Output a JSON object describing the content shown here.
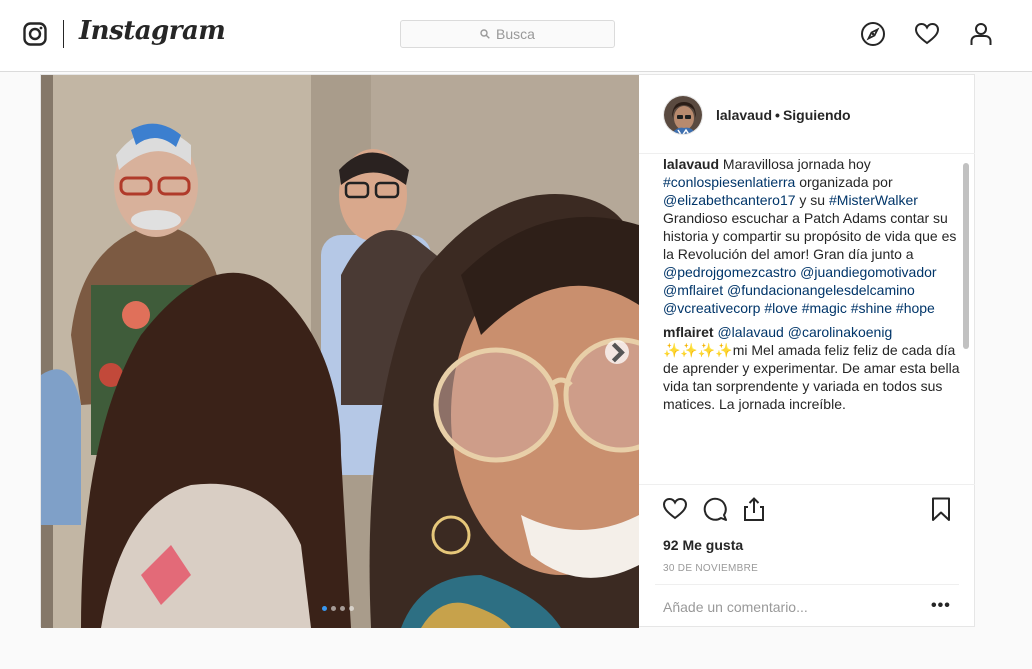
{
  "brand": {
    "wordmark": "Instagram"
  },
  "search": {
    "placeholder": "Busca"
  },
  "nav": {
    "icons": [
      "explore-icon",
      "heart-icon",
      "profile-icon"
    ]
  },
  "post": {
    "username": "lalavaud",
    "separator": "•",
    "follow_status": "Siguiendo",
    "carousel": {
      "total": 4,
      "active": 1
    },
    "caption": {
      "user": "lalavaud",
      "parts": [
        {
          "t": " Maravillosa jornada hoy "
        },
        {
          "t": "#conlospiesenlatierra",
          "link": true
        },
        {
          "t": " organizada por "
        },
        {
          "t": "@elizabethcantero17",
          "link": true
        },
        {
          "t": " y su "
        },
        {
          "t": "#MisterWalker",
          "link": true
        },
        {
          "t": " Grandioso escuchar a Patch Adams contar su historia y compartir su propósito de vida que es la Revolución del amor! Gran día junto a "
        },
        {
          "t": "@pedrojgomezcastro",
          "link": true
        },
        {
          "t": " "
        },
        {
          "t": "@juandiegomotivador",
          "link": true
        },
        {
          "t": " "
        },
        {
          "t": "@mflairet",
          "link": true
        },
        {
          "t": " "
        },
        {
          "t": "@fundacionangelesdelcamino",
          "link": true
        },
        {
          "t": " "
        },
        {
          "t": "@vcreativecorp",
          "link": true
        },
        {
          "t": " "
        },
        {
          "t": "#love",
          "link": true
        },
        {
          "t": " "
        },
        {
          "t": "#magic",
          "link": true
        },
        {
          "t": " "
        },
        {
          "t": "#shine",
          "link": true
        },
        {
          "t": " "
        },
        {
          "t": "#hope",
          "link": true
        }
      ]
    },
    "comment": {
      "user": "mflairet",
      "parts": [
        {
          "t": " "
        },
        {
          "t": "@lalavaud",
          "link": true
        },
        {
          "t": " "
        },
        {
          "t": "@carolinakoenig",
          "link": true
        },
        {
          "t": " ✨✨✨✨mi Mel amada feliz feliz de cada día de aprender y experimentar. De amar esta bella vida tan sorprendente y variada en todos sus matices. La jornada increíble."
        }
      ]
    },
    "likes": "92 Me gusta",
    "date": "30 DE NOVIEMBRE",
    "add_comment_placeholder": "Añade un comentario...",
    "more_label": "•••"
  },
  "colors": {
    "link": "#003569",
    "accent": "#3897f0",
    "border": "#dbdbdb"
  }
}
